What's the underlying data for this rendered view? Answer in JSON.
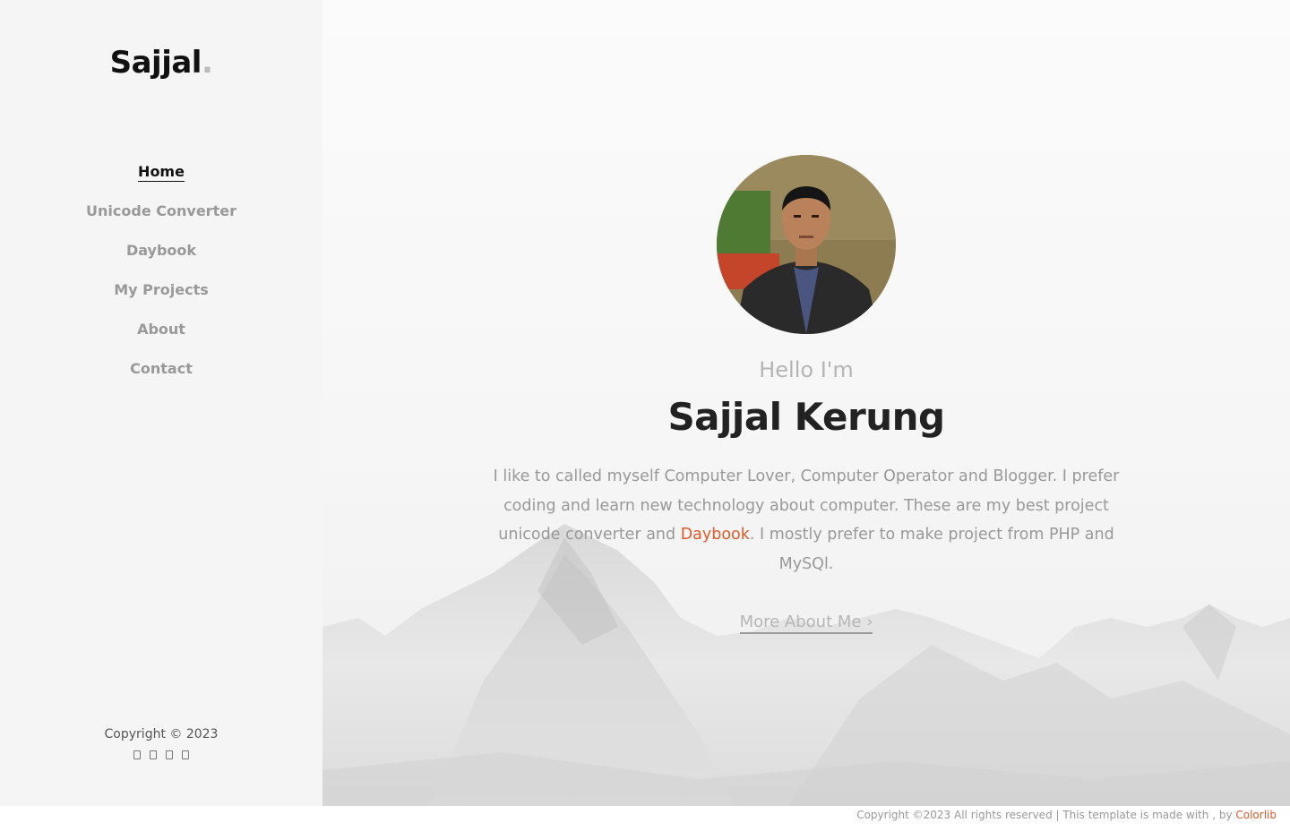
{
  "brand": {
    "name": "Sajjal",
    "dot": "."
  },
  "nav": {
    "items": [
      {
        "label": "Home",
        "active": true
      },
      {
        "label": "Unicode Converter"
      },
      {
        "label": "Daybook"
      },
      {
        "label": "My Projects"
      },
      {
        "label": "About"
      },
      {
        "label": "Contact"
      }
    ]
  },
  "sidebar_footer": {
    "copyright": "Copyright © 2023",
    "social_icons": [
      "facebook-icon",
      "twitter-icon",
      "instagram-icon",
      "linkedin-icon"
    ]
  },
  "hero": {
    "greeting": "Hello I'm",
    "name": "Sajjal Kerung",
    "bio_before": "I like to called myself Computer Lover, Computer Operator and Blogger. I prefer coding and learn new technology about computer. These are my best project unicode converter and ",
    "bio_link": "Daybook",
    "bio_after": ". I mostly prefer to make project from PHP and MySQl.",
    "more_label": "More About Me",
    "more_icon": "arrow-right-icon"
  },
  "footer": {
    "text": "Copyright ©2023 All rights reserved | This template is made with , by ",
    "link": "Colorlib"
  },
  "colors": {
    "accent": "#e05a2a",
    "sidebar_bg": "#f5f5f5",
    "text_dark": "#222222",
    "text_muted": "#999999"
  }
}
